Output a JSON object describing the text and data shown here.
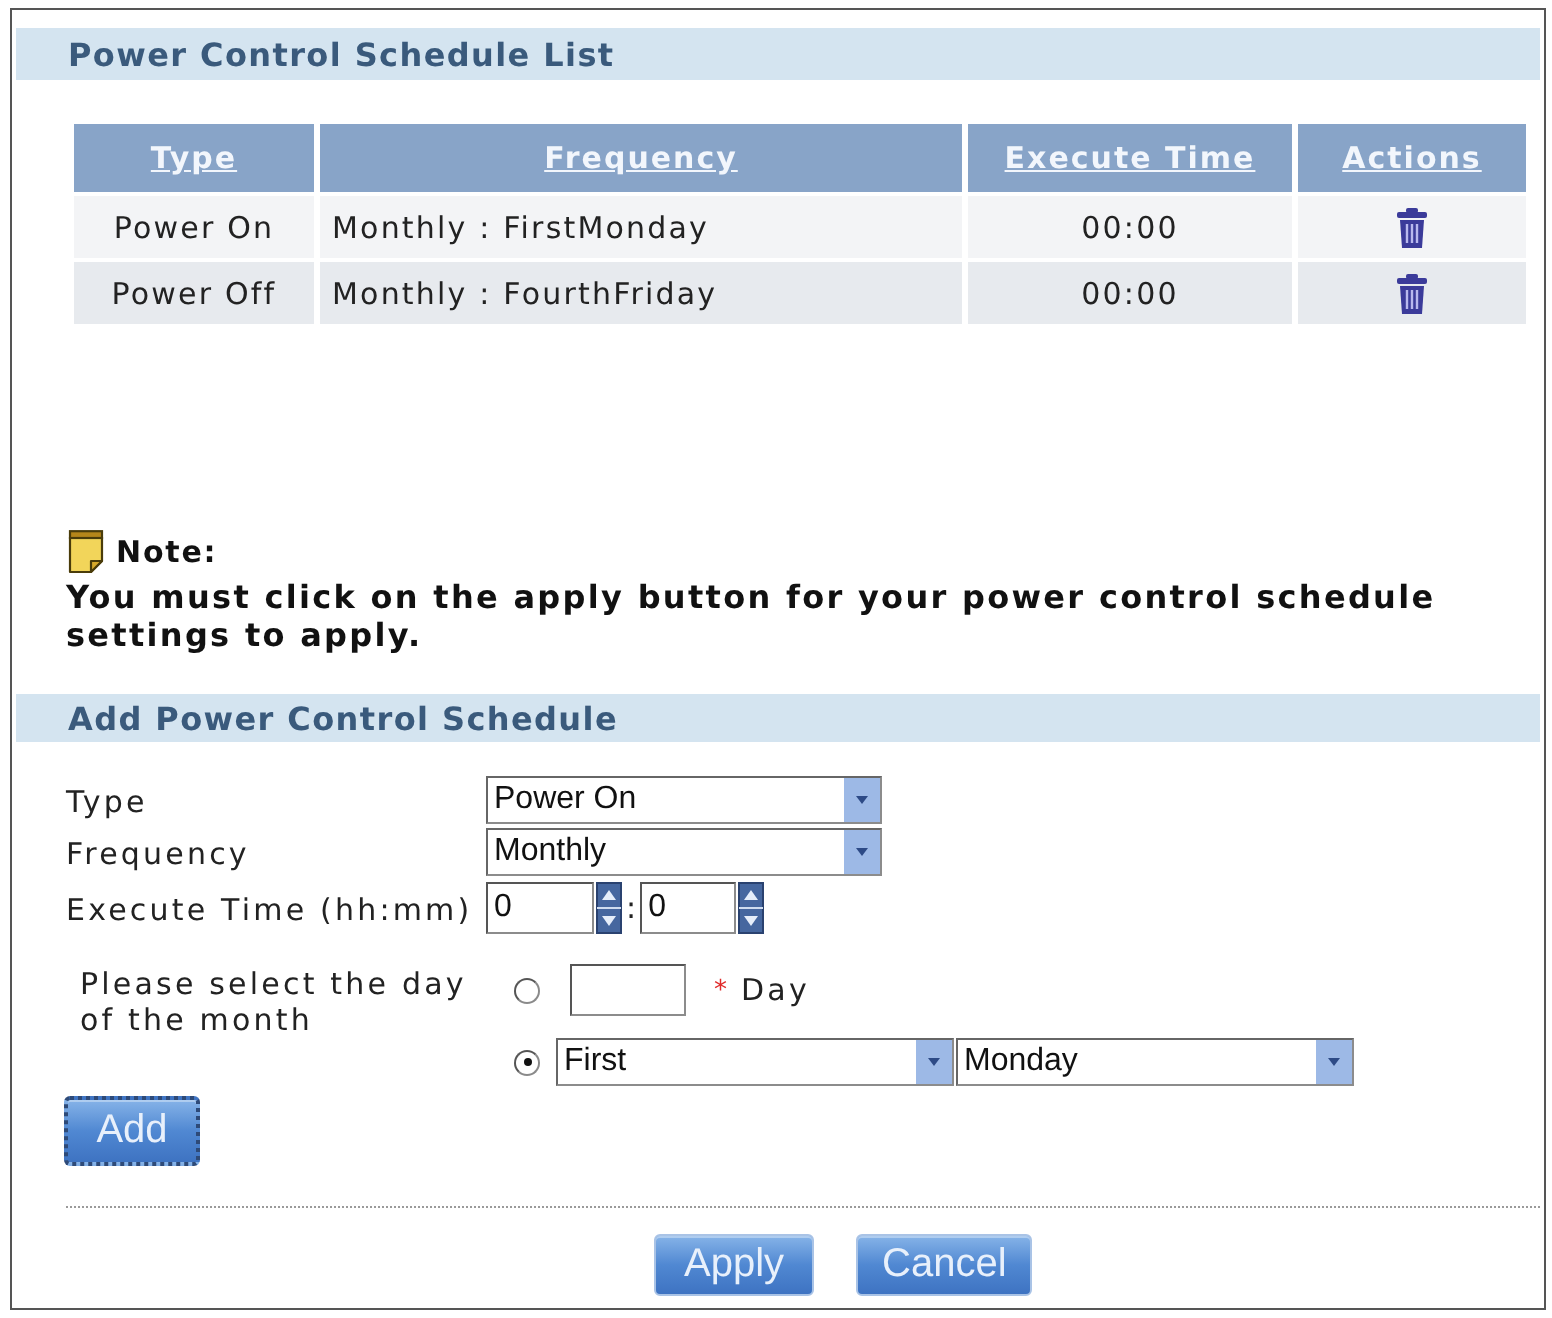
{
  "schedule_list": {
    "title": "Power Control Schedule List",
    "columns": [
      "Type",
      "Frequency",
      "Execute Time",
      "Actions"
    ],
    "rows": [
      {
        "type": "Power On",
        "frequency": "Monthly : FirstMonday",
        "execute_time": "00:00"
      },
      {
        "type": "Power Off",
        "frequency": "Monthly : FourthFriday",
        "execute_time": "00:00"
      }
    ]
  },
  "note": {
    "label": "Note:",
    "text": "You must click on the apply button for your power control schedule settings to apply."
  },
  "add_schedule": {
    "title": "Add Power Control Schedule",
    "fields": [
      {
        "kind": "select",
        "label": "Type",
        "value": "Power On"
      },
      {
        "kind": "select",
        "label": "Frequency",
        "value": "Monthly"
      },
      {
        "kind": "time",
        "label": "Execute Time (hh:mm)",
        "hour": "0",
        "separator": ":",
        "minute": "0"
      }
    ],
    "day": {
      "label": "Please select the day of the month",
      "options": [
        {
          "kind": "day_number",
          "selected": false,
          "required_mark": "*",
          "unit": "Day"
        },
        {
          "kind": "weekday",
          "selected": true,
          "week": "First",
          "weekday": "Monday"
        }
      ]
    },
    "add_button": "Add"
  },
  "buttons": [
    "Apply",
    "Cancel"
  ]
}
